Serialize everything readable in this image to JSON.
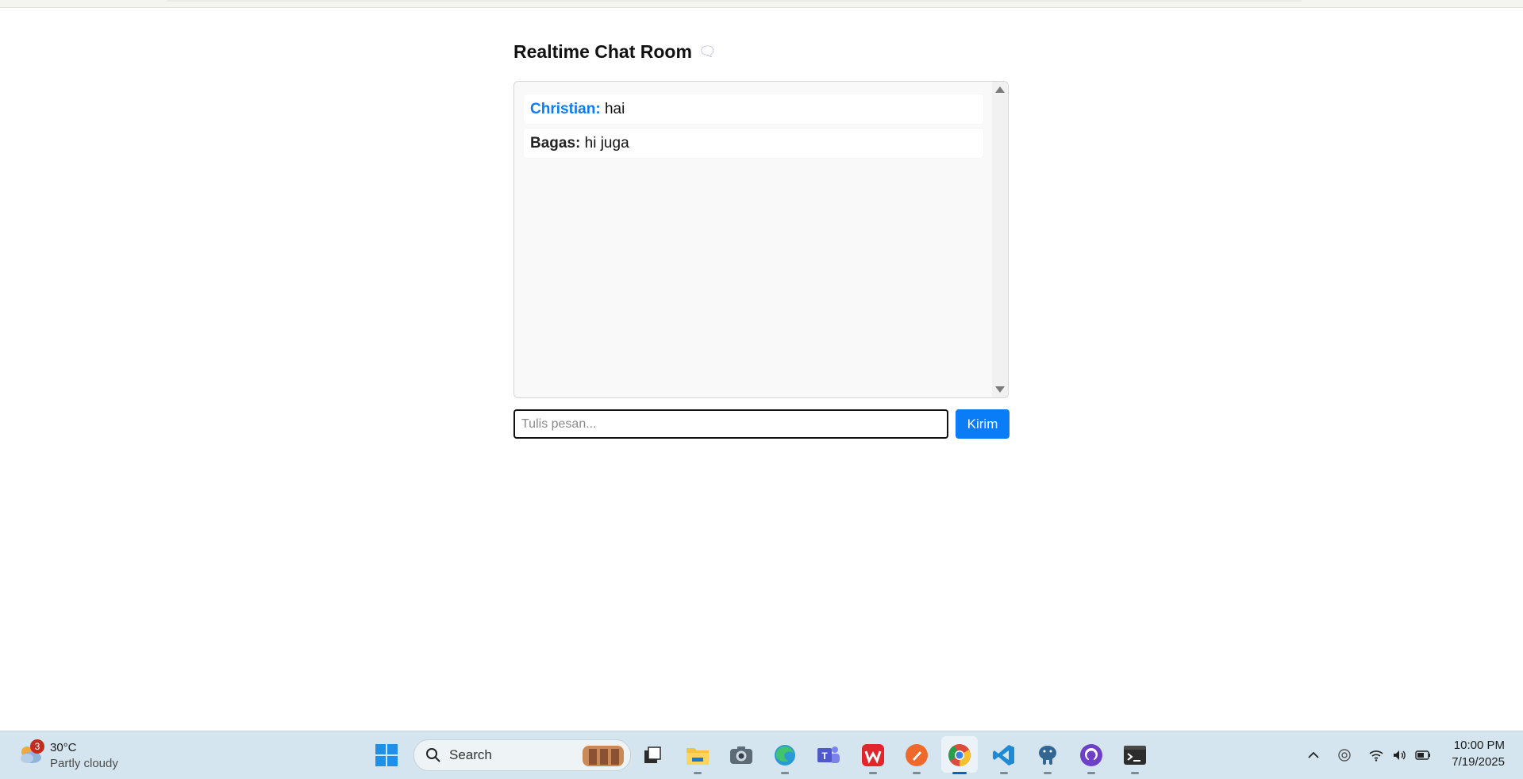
{
  "app": {
    "title": "Realtime Chat Room",
    "title_emoji": "🗨",
    "messages": [
      {
        "sender": "Christian:",
        "text": "hai",
        "is_self": true
      },
      {
        "sender": "Bagas:",
        "text": "hi juga",
        "is_self": false
      }
    ],
    "input_placeholder": "Tulis pesan...",
    "input_value": "",
    "send_label": "Kirim",
    "accent_color": "#0a7cf5"
  },
  "taskbar": {
    "weather": {
      "badge_count": "3",
      "temperature": "30°C",
      "condition": "Partly cloudy",
      "icon": "partly-cloudy-icon"
    },
    "search_label": "Search",
    "pinned_apps": [
      "windows-start-icon",
      "search-icon",
      "task-view-icon",
      "file-explorer-icon",
      "camera-icon",
      "edge-icon",
      "teams-icon",
      "wps-office-icon",
      "postman-icon",
      "chrome-icon",
      "vscode-icon",
      "postgresql-icon",
      "github-desktop-icon",
      "terminal-icon"
    ],
    "tray_icons": [
      "chevron-up-icon",
      "location-icon",
      "wifi-icon",
      "volume-icon",
      "battery-icon"
    ],
    "clock": {
      "time": "10:00 PM",
      "date": "7/19/2025"
    }
  }
}
